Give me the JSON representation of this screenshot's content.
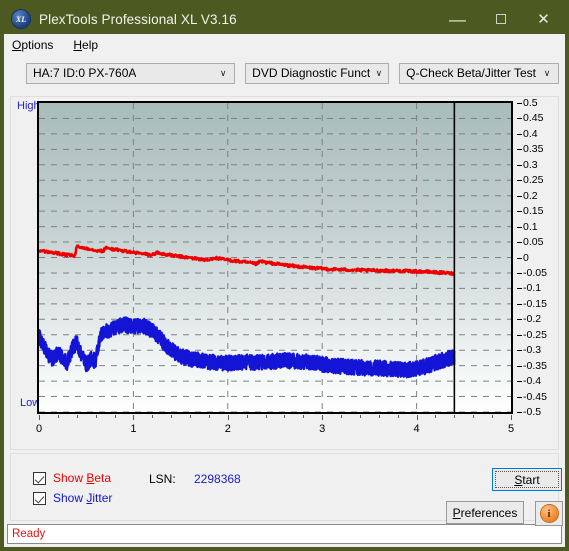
{
  "window": {
    "title": "PlexTools Professional XL V3.16",
    "app_icon": "XL",
    "minimize": "—",
    "maximize": "maximize-icon",
    "close": "✕"
  },
  "menu": {
    "items": [
      {
        "label": "Options",
        "mnemonic": "O"
      },
      {
        "label": "Help",
        "mnemonic": "H"
      }
    ]
  },
  "toolbar": {
    "drive_select": "HA:7 ID:0  PX-760A",
    "function_select": "DVD Diagnostic Functions",
    "test_select": "Q-Check Beta/Jitter Test",
    "chevron": "∨"
  },
  "controls": {
    "show_beta": "Show Beta",
    "show_beta_checked": true,
    "show_jitter": "Show Jitter",
    "show_jitter_checked": true,
    "lsn_label": "LSN:",
    "lsn_value": "2298368",
    "start_label": "Start",
    "preferences_label": "Preferences",
    "info_label": "i"
  },
  "status": {
    "text": "Ready"
  },
  "colors": {
    "titlebar": "#4c5a21",
    "beta_trace": "#ee0000",
    "jitter_trace": "#1414d6",
    "axis_label": "#2222cc",
    "status_text": "#e61212",
    "lsn_value": "#1c1ccd"
  },
  "chart_data": {
    "type": "line",
    "title": "Q-Check Beta/Jitter Test",
    "xlabel": "",
    "ylabel": "",
    "ylim": [
      -0.5,
      0.5
    ],
    "xlim": [
      0,
      5
    ],
    "grid": true,
    "legend_position": "external-bottom-left",
    "y_axis_top_label": "High",
    "y_axis_bottom_label": "Low",
    "yticks": [
      0.5,
      0.45,
      0.4,
      0.35,
      0.3,
      0.25,
      0.2,
      0.15,
      0.1,
      0.05,
      0,
      -0.05,
      -0.1,
      -0.15,
      -0.2,
      -0.25,
      -0.3,
      -0.35,
      -0.4,
      -0.45,
      -0.5
    ],
    "ytick_labels": [
      "0.5",
      "0.45",
      "0.4",
      "0.35",
      "0.3",
      "0.25",
      "0.2",
      "0.15",
      "0.1",
      "0.05",
      "0",
      "-0.05",
      "-0.1",
      "-0.15",
      "-0.2",
      "-0.25",
      "-0.3",
      "-0.35",
      "-0.4",
      "-0.45",
      "-0.5"
    ],
    "xticks": [
      0,
      1,
      2,
      3,
      4,
      5
    ],
    "xtick_labels": [
      "0",
      "1",
      "2",
      "3",
      "4",
      "5"
    ],
    "data_end_marker_x": 4.4,
    "series": [
      {
        "name": "Beta",
        "color": "#ee0000",
        "x": [
          0.0,
          0.1,
          0.2,
          0.3,
          0.38,
          0.4,
          0.5,
          0.6,
          0.68,
          0.7,
          0.8,
          0.9,
          1.0,
          1.1,
          1.2,
          1.25,
          1.3,
          1.4,
          1.5,
          1.6,
          1.7,
          1.8,
          1.85,
          1.9,
          2.0,
          2.1,
          2.2,
          2.3,
          2.35,
          2.4,
          2.5,
          2.6,
          2.7,
          2.8,
          2.9,
          3.0,
          3.1,
          3.2,
          3.3,
          3.4,
          3.5,
          3.6,
          3.7,
          3.8,
          3.9,
          4.0,
          4.1,
          4.2,
          4.3,
          4.4
        ],
        "y": [
          0.022,
          0.018,
          0.013,
          0.008,
          0.005,
          0.035,
          0.03,
          0.024,
          0.02,
          0.031,
          0.026,
          0.021,
          0.016,
          0.012,
          0.008,
          0.016,
          0.012,
          0.007,
          0.003,
          -0.001,
          -0.005,
          -0.009,
          0.0,
          -0.004,
          -0.008,
          -0.012,
          -0.016,
          -0.021,
          -0.012,
          -0.016,
          -0.02,
          -0.024,
          -0.028,
          -0.031,
          -0.034,
          -0.036,
          -0.038,
          -0.039,
          -0.04,
          -0.041,
          -0.042,
          -0.042,
          -0.043,
          -0.043,
          -0.044,
          -0.045,
          -0.046,
          -0.048,
          -0.05,
          -0.052
        ]
      },
      {
        "name": "Jitter",
        "color": "#1414d6",
        "x": [
          0.0,
          0.05,
          0.1,
          0.15,
          0.2,
          0.25,
          0.3,
          0.35,
          0.4,
          0.45,
          0.5,
          0.55,
          0.6,
          0.65,
          0.7,
          0.75,
          0.8,
          0.85,
          0.9,
          0.95,
          1.0,
          1.05,
          1.1,
          1.15,
          1.2,
          1.25,
          1.3,
          1.35,
          1.4,
          1.45,
          1.5,
          1.6,
          1.7,
          1.8,
          1.9,
          2.0,
          2.1,
          2.2,
          2.3,
          2.4,
          2.5,
          2.6,
          2.7,
          2.8,
          2.9,
          3.0,
          3.1,
          3.2,
          3.3,
          3.4,
          3.5,
          3.6,
          3.7,
          3.8,
          3.9,
          4.0,
          4.1,
          4.2,
          4.3,
          4.4
        ],
        "y": [
          -0.255,
          -0.285,
          -0.315,
          -0.33,
          -0.31,
          -0.325,
          -0.34,
          -0.295,
          -0.275,
          -0.32,
          -0.345,
          -0.33,
          -0.335,
          -0.25,
          -0.235,
          -0.24,
          -0.228,
          -0.222,
          -0.218,
          -0.22,
          -0.225,
          -0.222,
          -0.22,
          -0.228,
          -0.235,
          -0.25,
          -0.268,
          -0.285,
          -0.298,
          -0.31,
          -0.32,
          -0.328,
          -0.332,
          -0.338,
          -0.34,
          -0.342,
          -0.34,
          -0.338,
          -0.34,
          -0.338,
          -0.336,
          -0.334,
          -0.335,
          -0.337,
          -0.34,
          -0.345,
          -0.35,
          -0.352,
          -0.355,
          -0.356,
          -0.358,
          -0.358,
          -0.36,
          -0.362,
          -0.363,
          -0.36,
          -0.352,
          -0.34,
          -0.33,
          -0.322
        ]
      }
    ]
  }
}
